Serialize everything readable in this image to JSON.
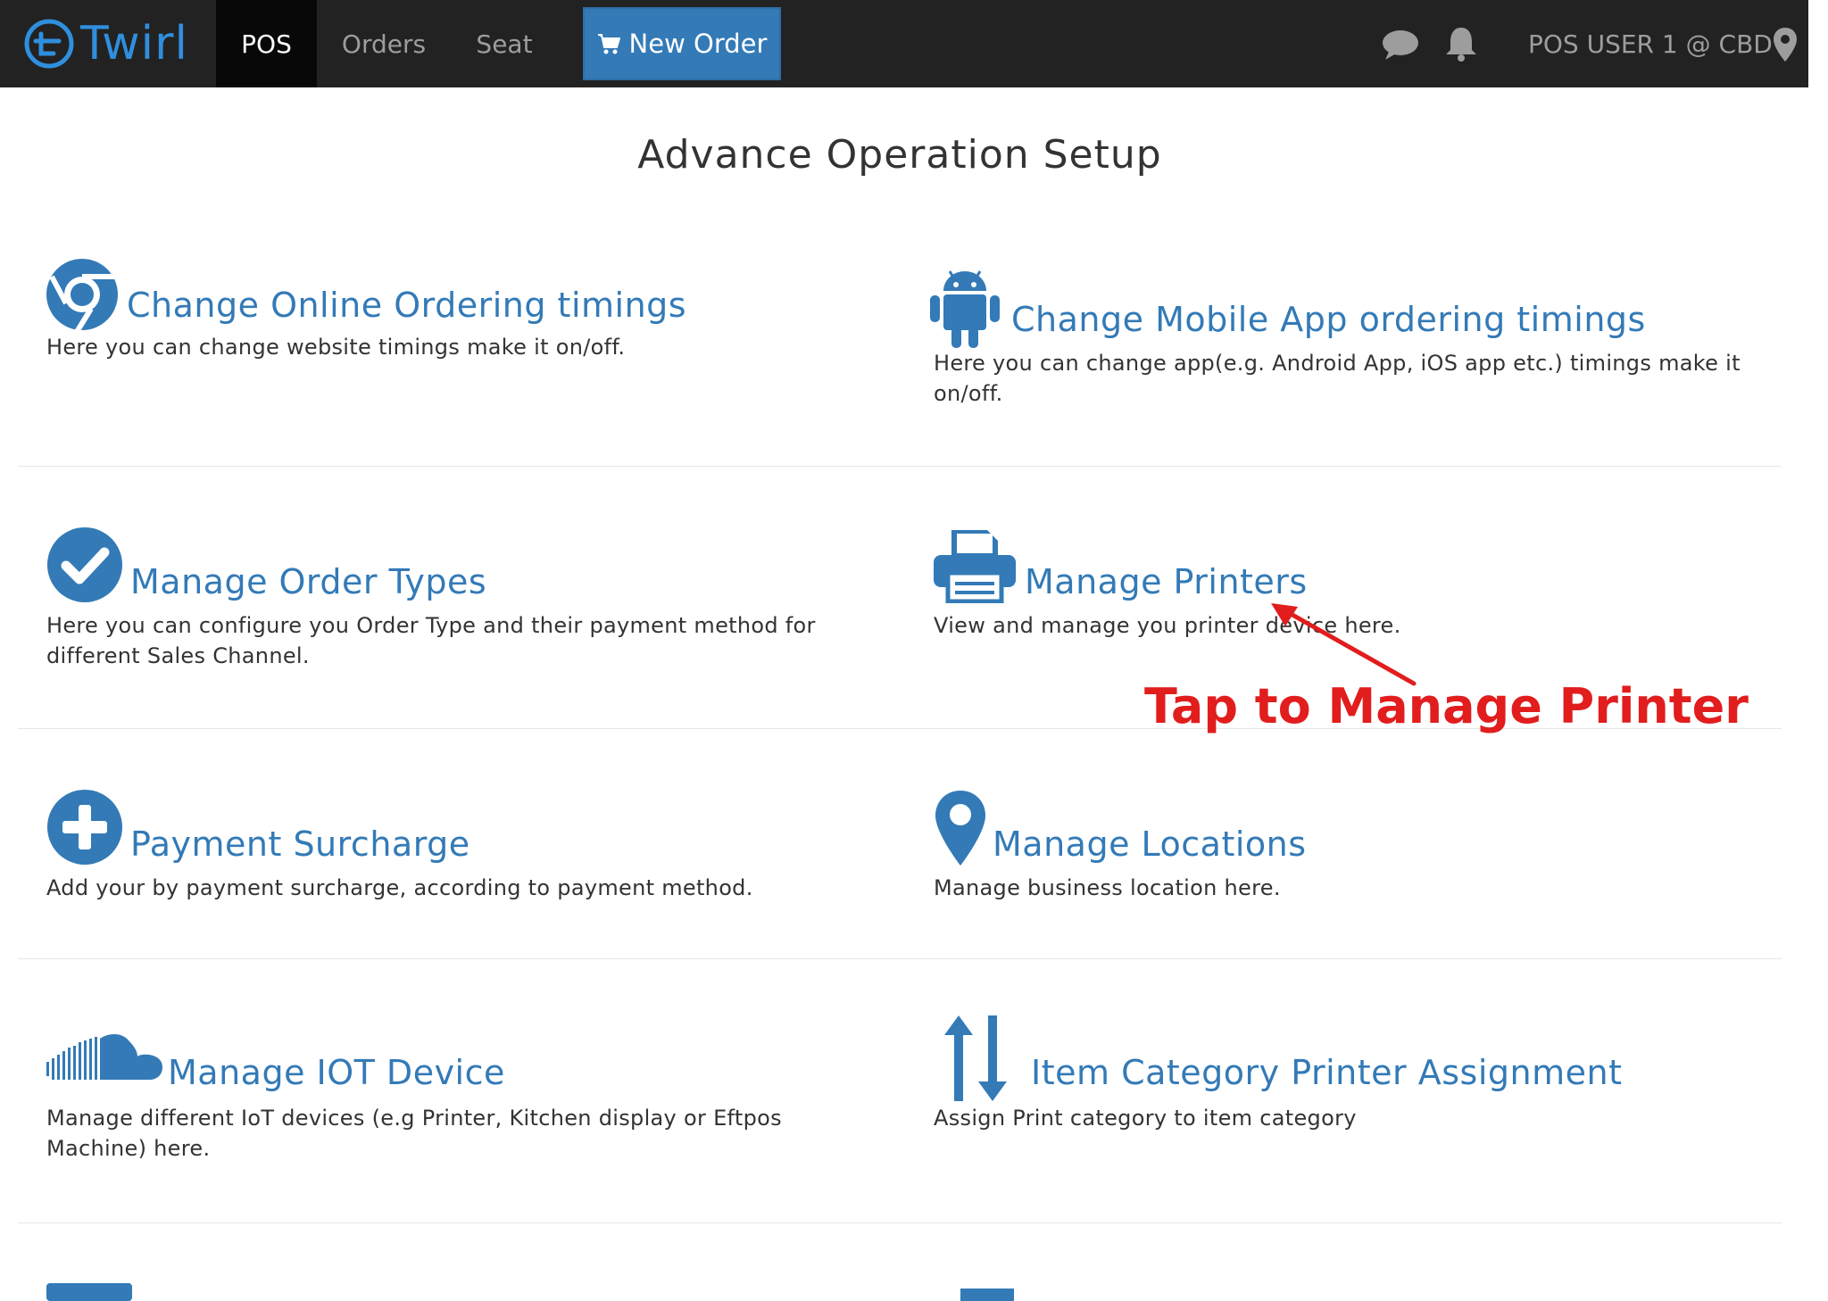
{
  "navbar": {
    "logo_text": "Twirl",
    "tabs": [
      {
        "label": "POS"
      },
      {
        "label": "Orders"
      },
      {
        "label": "Seat"
      }
    ],
    "new_order_label": "New Order",
    "user_label": "POS USER 1 @ CBD"
  },
  "page": {
    "title": "Advance Operation Setup"
  },
  "items": [
    {
      "title": "Change Online Ordering timings",
      "desc": "Here you can change website timings make it on/off.",
      "icon": "chrome-icon"
    },
    {
      "title": "Change Mobile App ordering timings",
      "desc": "Here you can change app(e.g. Android App, iOS app etc.) timings make it on/off.",
      "icon": "android-icon"
    },
    {
      "title": "Manage Order Types",
      "desc": "Here you can configure you Order Type and their payment method for different Sales Channel.",
      "icon": "check-circle-icon"
    },
    {
      "title": "Manage Printers",
      "desc": "View and manage you printer device here.",
      "icon": "printer-icon"
    },
    {
      "title": "Payment Surcharge",
      "desc": "Add your by payment surcharge, according to payment method.",
      "icon": "plus-circle-icon"
    },
    {
      "title": "Manage Locations",
      "desc": "Manage business location here.",
      "icon": "map-marker-icon"
    },
    {
      "title": "Manage IOT Device",
      "desc": "Manage different IoT devices (e.g Printer, Kitchen display or Eftpos Machine) here.",
      "icon": "soundcloud-icon"
    },
    {
      "title": "Item Category Printer Assignment",
      "desc": "Assign Print category to item category",
      "icon": "sort-arrows-icon"
    }
  ],
  "annotation": {
    "text": "Tap to Manage Printer",
    "color": "#e11d1d"
  },
  "colors": {
    "nav_bg": "#222222",
    "accent": "#337ab7",
    "logo": "#2f8fde"
  }
}
